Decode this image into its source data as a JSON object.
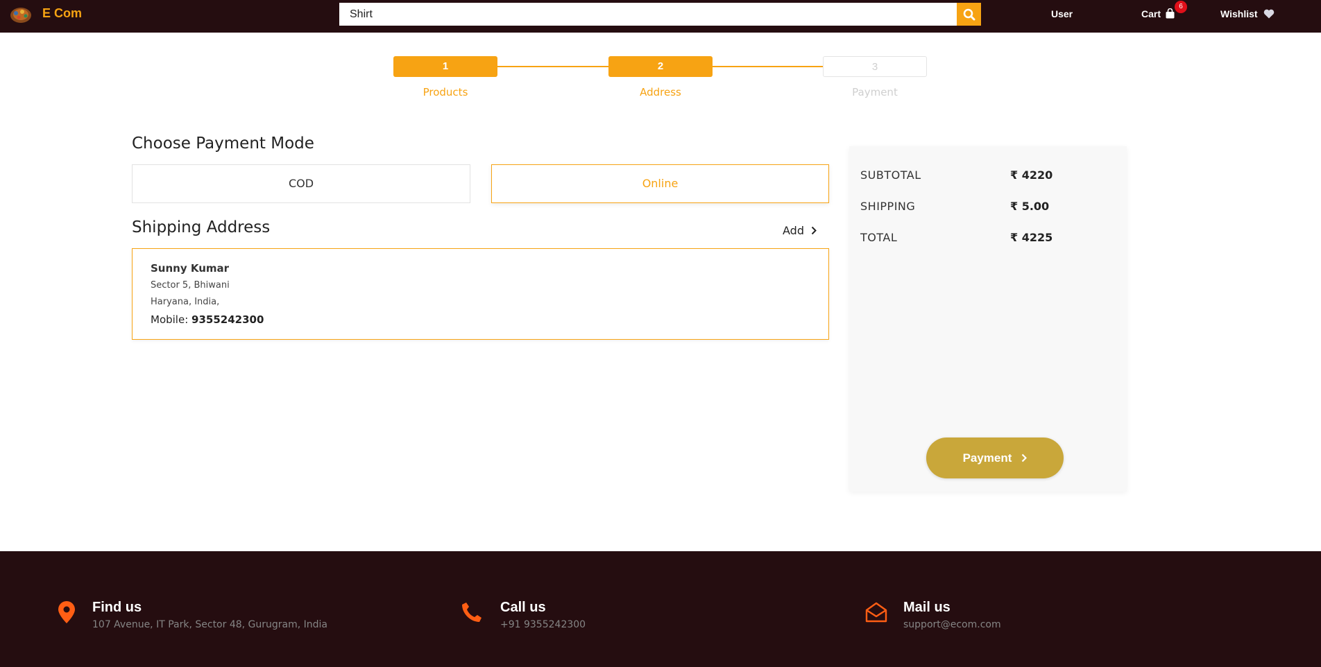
{
  "header": {
    "brand": "E Com",
    "search": {
      "value": "Shirt",
      "placeholder": ""
    },
    "nav": {
      "user": "User",
      "cart": "Cart",
      "cart_count": "6",
      "wishlist": "Wishlist"
    }
  },
  "stepper": {
    "steps": [
      {
        "number": "1",
        "label": "Products",
        "state": "completed"
      },
      {
        "number": "2",
        "label": "Address",
        "state": "active"
      },
      {
        "number": "3",
        "label": "Payment",
        "state": "pending"
      }
    ]
  },
  "payment_mode": {
    "title": "Choose Payment Mode",
    "options": [
      {
        "label": "COD",
        "selected": false
      },
      {
        "label": "Online",
        "selected": true
      }
    ]
  },
  "shipping": {
    "title": "Shipping Address",
    "add_label": "Add",
    "address": {
      "name": "Sunny Kumar",
      "line1": "Sector 5, Bhiwani",
      "line2": "Haryana, India,",
      "mobile_label": "Mobile:",
      "mobile": "9355242300"
    }
  },
  "summary": {
    "rows": [
      {
        "label": "SUBTOTAL",
        "value": "₹ 4220"
      },
      {
        "label": "SHIPPING",
        "value": "₹ 5.00"
      },
      {
        "label": "TOTAL",
        "value": "₹ 4225"
      }
    ],
    "button_label": "Payment"
  },
  "footer": {
    "items": [
      {
        "title": "Find us",
        "text": "107 Avenue, IT Park, Sector 48, Gurugram, India",
        "icon": "map-marker-icon"
      },
      {
        "title": "Call us",
        "text": "+91 9355242300",
        "icon": "phone-icon"
      },
      {
        "title": "Mail us",
        "text": "support@ecom.com",
        "icon": "envelope-open-icon"
      }
    ]
  },
  "colors": {
    "header_bg": "#250d10",
    "accent": "#f7a313",
    "payment_button": "#c9a73a",
    "badge": "#e0101a",
    "footer_icon": "#ff5e14"
  }
}
